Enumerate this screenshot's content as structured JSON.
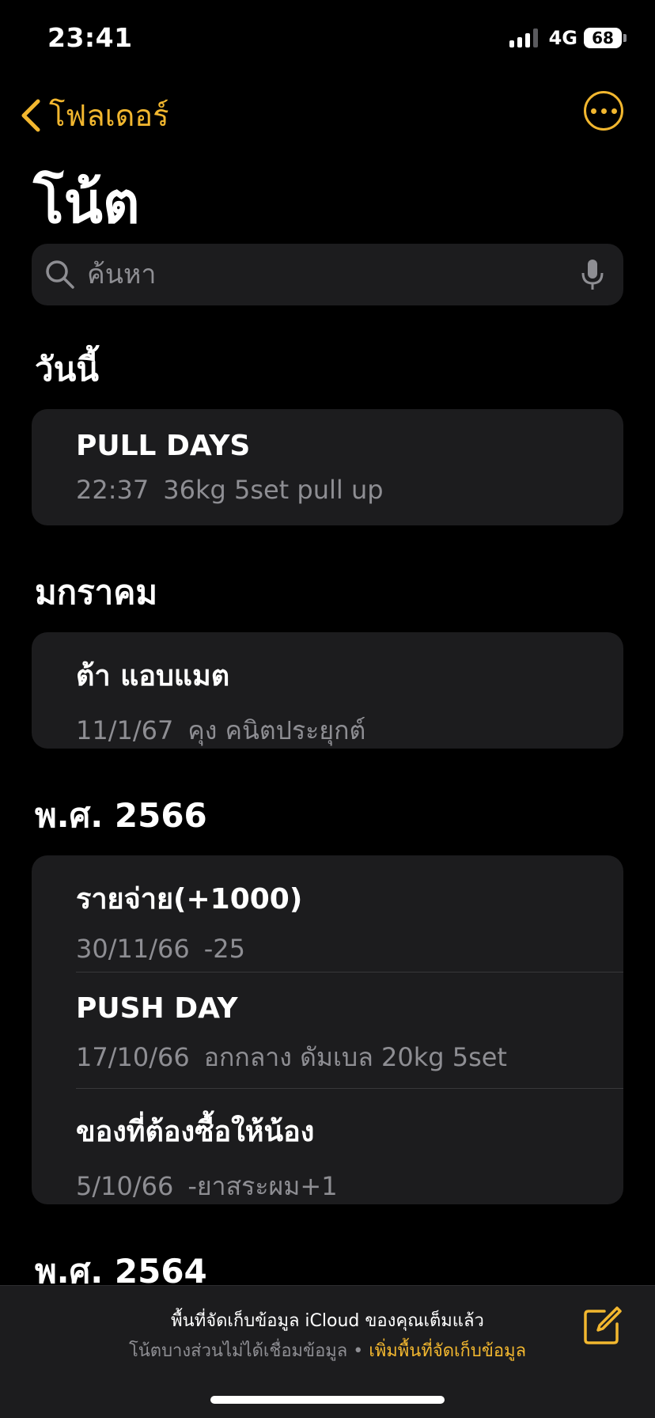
{
  "status_bar": {
    "time": "23:41",
    "network": "4G",
    "battery": "68"
  },
  "nav": {
    "back_label": "โฟลเดอร์"
  },
  "title": "โน้ต",
  "search": {
    "placeholder": "ค้นหา"
  },
  "sections": [
    {
      "header": "วันนี้",
      "notes": [
        {
          "title": "PULL DAYS",
          "date": "22:37",
          "preview": "36kg 5set pull up"
        }
      ]
    },
    {
      "header": "มกราคม",
      "notes": [
        {
          "title": "ต้า แอบแมต",
          "date": "11/1/67",
          "preview": "คุง คนิตประยุกต์"
        }
      ]
    },
    {
      "header": "พ.ศ. 2566",
      "notes": [
        {
          "title": "รายจ่าย(+1000)",
          "date": "30/11/66",
          "preview": "-25"
        },
        {
          "title": "PUSH DAY",
          "date": "17/10/66",
          "preview": "อกกลาง ดัมเบล 20kg 5set"
        },
        {
          "title": "ของที่ต้องซื้อให้น้อง",
          "date": "5/10/66",
          "preview": "-ยาสระผม+1"
        }
      ]
    },
    {
      "header": "พ.ศ. 2564",
      "notes": []
    }
  ],
  "bottom_bar": {
    "icloud_message": "พื้นที่จัดเก็บข้อมูล iCloud ของคุณเต็มแล้ว",
    "sync_message": "โน้ตบางส่วนไม่ได้เชื่อมข้อมูล",
    "separator": "•",
    "add_storage_label": "เพิ่มพื้นที่จัดเก็บข้อมูล"
  },
  "colors": {
    "accent": "#f2b72f",
    "card": "#1c1c1e",
    "secondary_text": "#8e8e93",
    "background": "#000000"
  }
}
